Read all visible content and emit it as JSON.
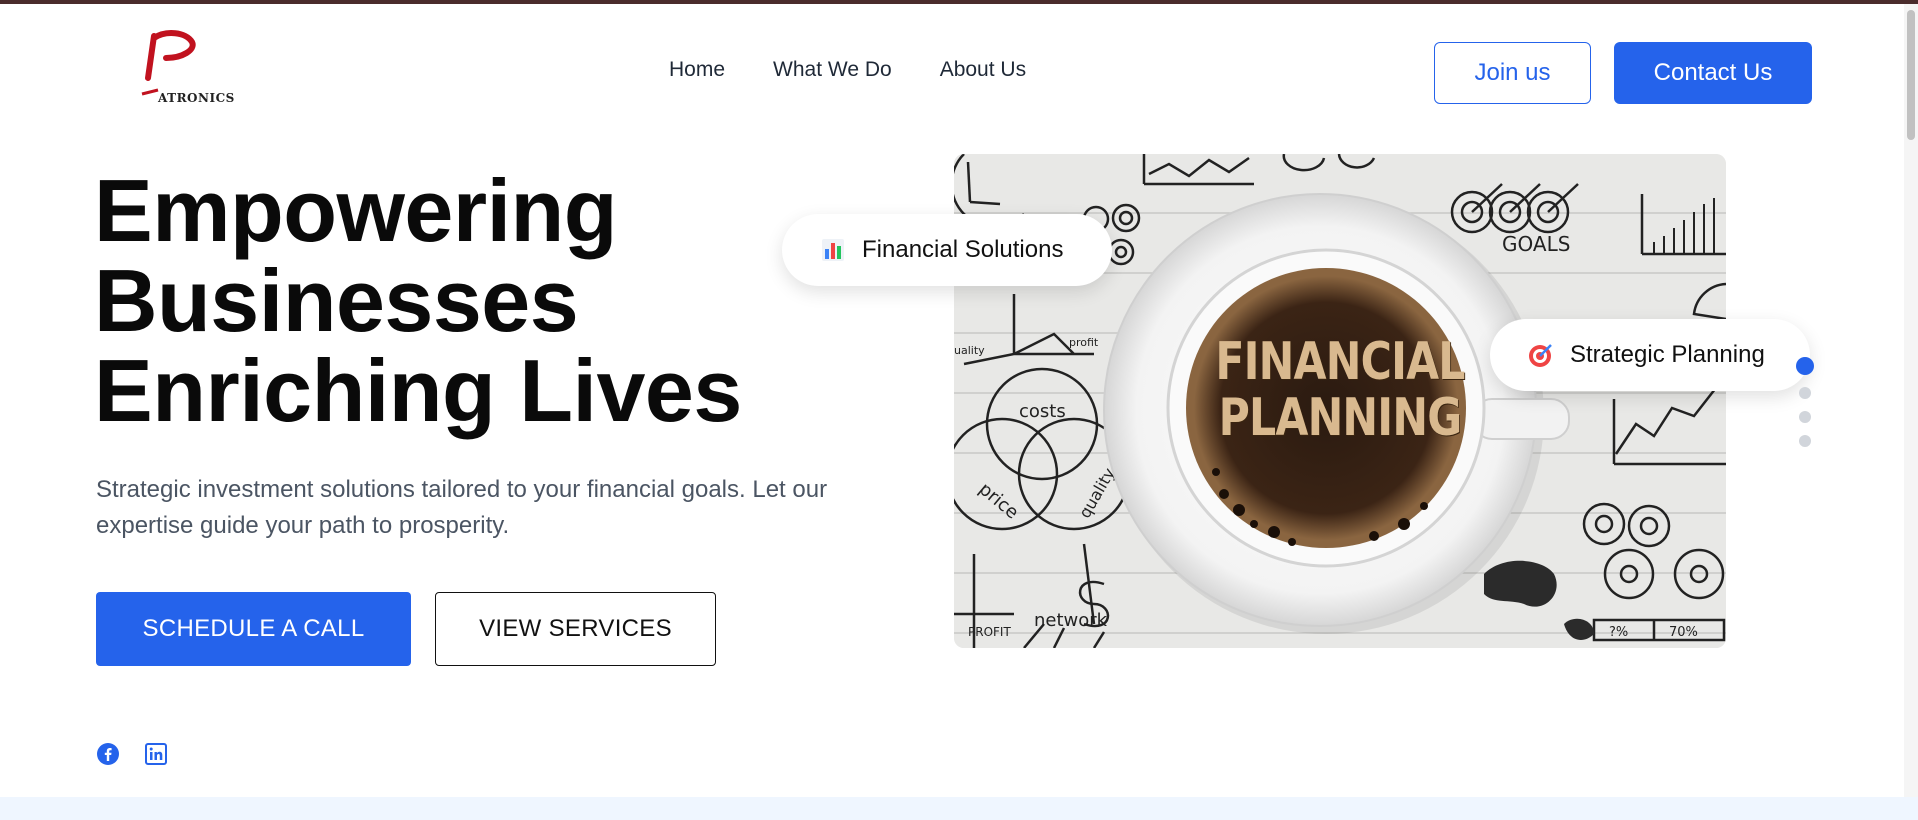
{
  "brand": {
    "logo_text": "ATRONICS",
    "logo_letter": "p"
  },
  "nav": {
    "items": [
      {
        "label": "Home"
      },
      {
        "label": "What We Do"
      },
      {
        "label": "About Us"
      }
    ]
  },
  "header_actions": {
    "join_label": "Join us",
    "contact_label": "Contact Us"
  },
  "hero": {
    "title_line1": "Empowering",
    "title_line2": "Businesses",
    "title_line3": "Enriching Lives",
    "description": "Strategic investment solutions tailored to your financial goals. Let our expertise guide your path to prosperity.",
    "primary_cta": "SCHEDULE A CALL",
    "secondary_cta": "VIEW SERVICES"
  },
  "image": {
    "cup_line1": "FINANCIAL",
    "cup_line2": "PLANNING",
    "sketch_labels": {
      "goals": "GOALS",
      "costs": "costs",
      "price": "price",
      "quality": "quality",
      "network": "network",
      "profit": "PROFIT",
      "profit_axis": "profit",
      "percent_a": "?%",
      "percent_b": "70%",
      "quality_axis": "uality"
    }
  },
  "pills": {
    "financial": {
      "label": "Financial Solutions",
      "icon": "bar-chart-icon"
    },
    "strategic": {
      "label": "Strategic Planning",
      "icon": "target-icon"
    }
  },
  "carousel": {
    "total": 4,
    "active": 1
  },
  "social": [
    "facebook-icon",
    "linkedin-icon"
  ],
  "colors": {
    "accent": "#2563eb",
    "text_dark": "#0a0a0a",
    "text_muted": "#4b5563",
    "band": "#eff6ff",
    "topline": "#4a2c2c"
  }
}
